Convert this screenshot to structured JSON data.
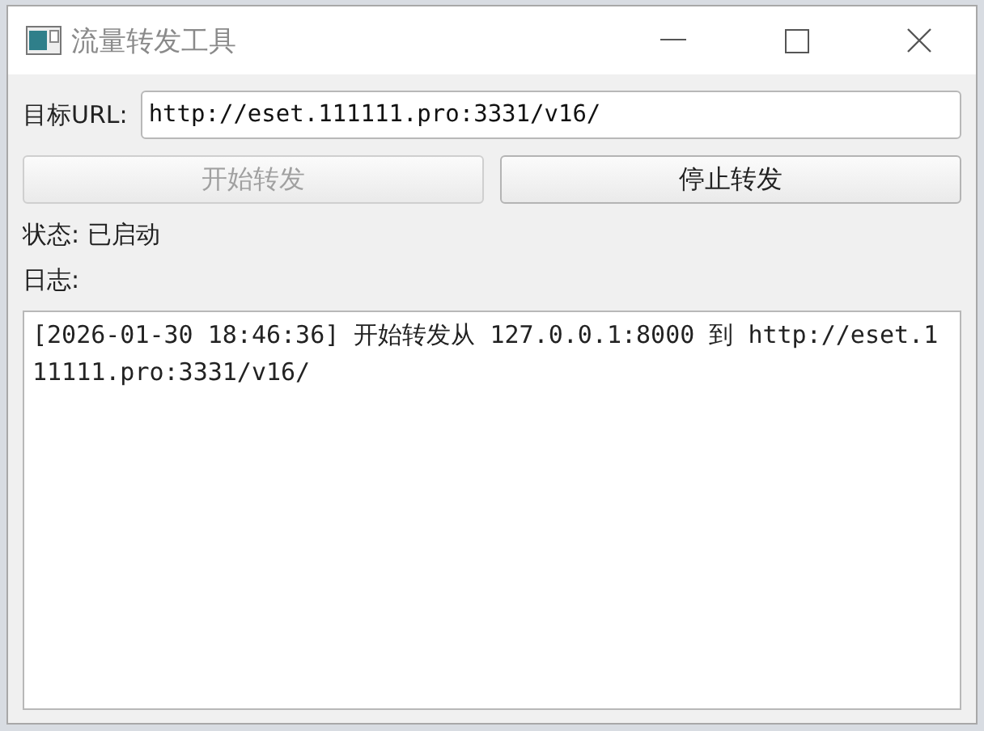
{
  "window": {
    "title": "流量转发工具"
  },
  "url_field": {
    "label": "目标URL:",
    "value": "http://eset.111111.pro:3331/v16/"
  },
  "buttons": [
    {
      "label": "开始转发",
      "disabled": true
    },
    {
      "label": "停止转发",
      "disabled": false
    }
  ],
  "status": "状态: 已启动",
  "log": {
    "label": "日志:",
    "text": "[2026-01-30 18:46:36] 开始转发从 127.0.0.1:8000 到 http://eset.111111.pro:3331/v16/"
  }
}
